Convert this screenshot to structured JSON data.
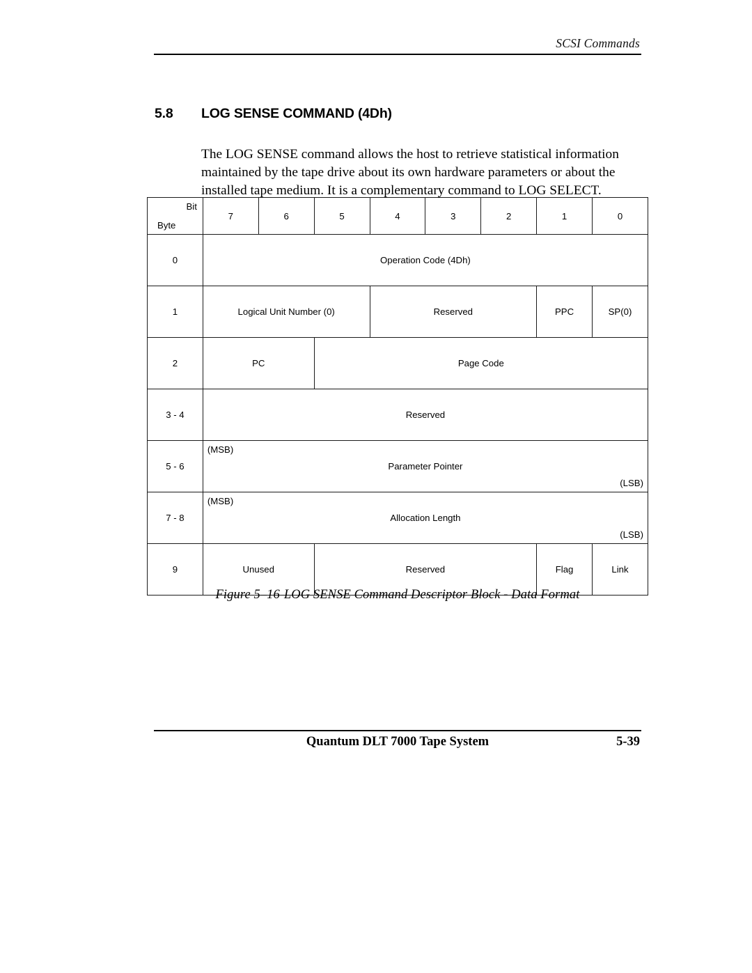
{
  "header": {
    "running_title": "SCSI Commands"
  },
  "section": {
    "number": "5.8",
    "title": "LOG SENSE COMMAND  (4Dh)"
  },
  "body": {
    "paragraph": "The LOG SENSE command allows the host to retrieve statistical information maintained by the tape drive about its own hardware parameters or about the installed tape medium. It is a complementary command to LOG SELECT."
  },
  "cdb_table": {
    "corner": {
      "bit_label": "Bit",
      "byte_label": "Byte"
    },
    "bit_headers": [
      "7",
      "6",
      "5",
      "4",
      "3",
      "2",
      "1",
      "0"
    ],
    "rows": [
      {
        "byte": "0",
        "cells": [
          {
            "text": "Operation Code (4Dh)",
            "span": 8
          }
        ]
      },
      {
        "byte": "1",
        "cells": [
          {
            "text": "Logical Unit Number (0)",
            "span": 3
          },
          {
            "text": "Reserved",
            "span": 3
          },
          {
            "text": "PPC",
            "span": 1
          },
          {
            "text": "SP(0)",
            "span": 1
          }
        ]
      },
      {
        "byte": "2",
        "cells": [
          {
            "text": "PC",
            "span": 2
          },
          {
            "text": "Page Code",
            "span": 6
          }
        ]
      },
      {
        "byte": "3 - 4",
        "cells": [
          {
            "text": "Reserved",
            "span": 8
          }
        ]
      },
      {
        "byte": "5 - 6",
        "cells": [
          {
            "text": "Parameter Pointer",
            "span": 8,
            "msb": "(MSB)",
            "lsb": "(LSB)"
          }
        ]
      },
      {
        "byte": "7 - 8",
        "cells": [
          {
            "text": "Allocation Length",
            "span": 8,
            "msb": "(MSB)",
            "lsb": "(LSB)"
          }
        ]
      },
      {
        "byte": "9",
        "cells": [
          {
            "text": "Unused",
            "span": 2
          },
          {
            "text": "Reserved",
            "span": 4
          },
          {
            "text": "Flag",
            "span": 1
          },
          {
            "text": "Link",
            "span": 1
          }
        ]
      }
    ]
  },
  "figure": {
    "label": "Figure 5–16",
    "caption": "LOG SENSE Command Descriptor Block - Data Format"
  },
  "footer": {
    "document_title": "Quantum DLT 7000 Tape System",
    "page_number": "5-39"
  }
}
